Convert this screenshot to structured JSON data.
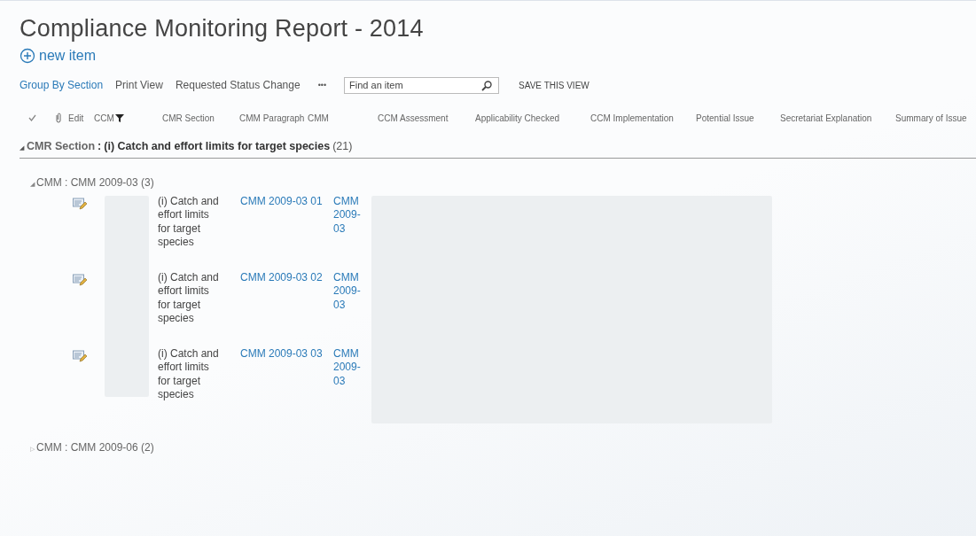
{
  "title": "Compliance Monitoring Report - 2014",
  "new_item": "new item",
  "views": [
    {
      "label": "Group By Section",
      "selected": true
    },
    {
      "label": "Print View",
      "selected": false
    },
    {
      "label": "Requested Status Change",
      "selected": false
    }
  ],
  "more": "•••",
  "search": {
    "placeholder": "Find an item"
  },
  "save_view": "SAVE THIS VIEW",
  "columns": [
    {
      "kind": "check"
    },
    {
      "kind": "attach"
    },
    {
      "kind": "text",
      "label": "Edit"
    },
    {
      "kind": "filtered",
      "label": "CCM"
    },
    {
      "kind": "text",
      "label": "CMR Section"
    },
    {
      "kind": "text",
      "label": "CMM Paragraph"
    },
    {
      "kind": "text",
      "label": "CMM"
    },
    {
      "kind": "text",
      "label": "CCM Assessment"
    },
    {
      "kind": "text",
      "label": "Applicability Checked"
    },
    {
      "kind": "text",
      "label": "CCM Implementation"
    },
    {
      "kind": "text",
      "label": "Potential Issue"
    },
    {
      "kind": "text",
      "label": "Secretariat Explanation"
    },
    {
      "kind": "text",
      "label": "Summary of Issue"
    }
  ],
  "group": {
    "toggle": "◢",
    "label": "CMR Section",
    "separator": ":",
    "value": "(i) Catch and effort limits for target species",
    "count": "(21)",
    "expanded": true,
    "subgroups": [
      {
        "toggle": "◢",
        "label": "CMM",
        "separator": ":",
        "value": "CMM 2009-03",
        "count": "(3)",
        "expanded": true,
        "rows": [
          {
            "section": "(i) Catch and effort limits for target species",
            "paragraph": "CMM 2009-03 01",
            "cmm": "CMM 2009-03"
          },
          {
            "section": "(i) Catch and effort limits for target species",
            "paragraph": "CMM 2009-03 02",
            "cmm": "CMM 2009-03"
          },
          {
            "section": "(i) Catch and effort limits for target species",
            "paragraph": "CMM 2009-03 03",
            "cmm": "CMM 2009-03"
          }
        ]
      },
      {
        "toggle": "▷",
        "label": "CMM",
        "separator": ":",
        "value": "CMM 2009-06",
        "count": "(2)",
        "expanded": false
      }
    ]
  }
}
